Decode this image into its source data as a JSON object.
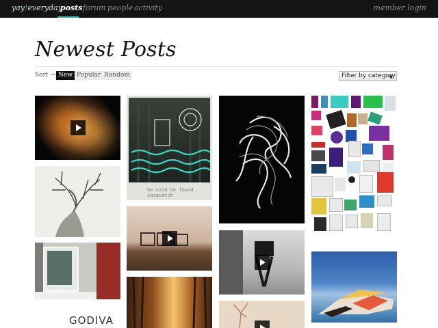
{
  "nav": {
    "brand_prefix": "yay",
    "brand_excl": "!",
    "brand_suffix": "everyday",
    "items": [
      {
        "label": "posts",
        "active": true
      },
      {
        "label": "forum",
        "active": false
      },
      {
        "label": "people",
        "active": false
      },
      {
        "label": "activity",
        "active": false
      }
    ],
    "login": "member login",
    "accent": "#28c5b5"
  },
  "page": {
    "title": "Newest Posts"
  },
  "sort": {
    "label": "Sort →",
    "options": [
      {
        "label": "New",
        "active": true
      },
      {
        "label": "Popular",
        "active": false
      },
      {
        "label": "Random",
        "active": false
      }
    ],
    "filter_label": "Filter by category"
  },
  "posts": [
    {
      "subject": "glowing sun mask video",
      "is_video": true
    },
    {
      "subject": "stag skull pencil drawing",
      "is_video": false
    },
    {
      "subject": "window with shutter photo",
      "is_video": false
    },
    {
      "subject": "godiva typography",
      "is_video": false,
      "text": "GODIVA"
    },
    {
      "subject": "forest drawing polaroid",
      "is_video": false,
      "caption": "he said he found sasquatch"
    },
    {
      "subject": "beach chairs at sunset video",
      "is_video": true
    },
    {
      "subject": "sunlit forest photo",
      "is_video": false
    },
    {
      "subject": "abstract black and white sculpture",
      "is_video": false
    },
    {
      "subject": "camera on tripod video",
      "is_video": true
    },
    {
      "subject": "tree sketch video",
      "is_video": true
    },
    {
      "subject": "design collage",
      "is_video": false
    },
    {
      "subject": "abstract paper folding painting",
      "is_video": false
    }
  ]
}
